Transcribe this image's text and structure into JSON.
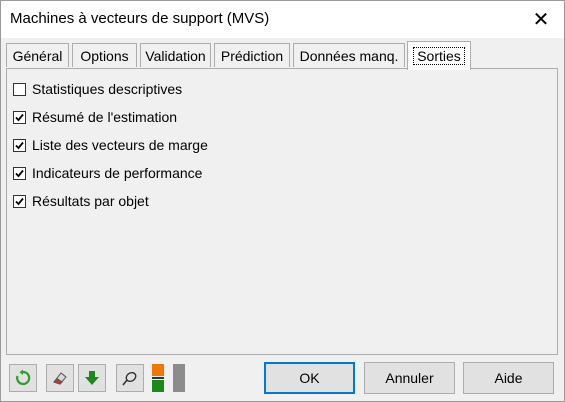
{
  "window": {
    "title": "Machines à vecteurs de support (MVS)",
    "close_glyph": "✕"
  },
  "tabs": [
    {
      "label": "Général",
      "active": false
    },
    {
      "label": "Options",
      "active": false
    },
    {
      "label": "Validation",
      "active": false
    },
    {
      "label": "Prédiction",
      "active": false
    },
    {
      "label": "Données manq.",
      "active": false
    },
    {
      "label": "Sorties",
      "active": true
    }
  ],
  "outputs": [
    {
      "label": "Statistiques descriptives",
      "checked": false
    },
    {
      "label": "Résumé de l'estimation",
      "checked": true
    },
    {
      "label": "Liste des vecteurs de marge",
      "checked": true
    },
    {
      "label": "Indicateurs de performance",
      "checked": true
    },
    {
      "label": "Résultats par objet",
      "checked": true
    }
  ],
  "toolbar": {
    "icons": [
      "reset-icon",
      "eraser-icon",
      "down-arrow-icon",
      "pin-icon",
      "swap-colors-icon"
    ],
    "colors": {
      "reset": "#2e9e2e",
      "arrow": "#1a8a1a",
      "orange": "#f07800",
      "green": "#1a8a1a",
      "gray": "#8c8c8c"
    }
  },
  "buttons": {
    "ok": "OK",
    "cancel": "Annuler",
    "help": "Aide"
  }
}
